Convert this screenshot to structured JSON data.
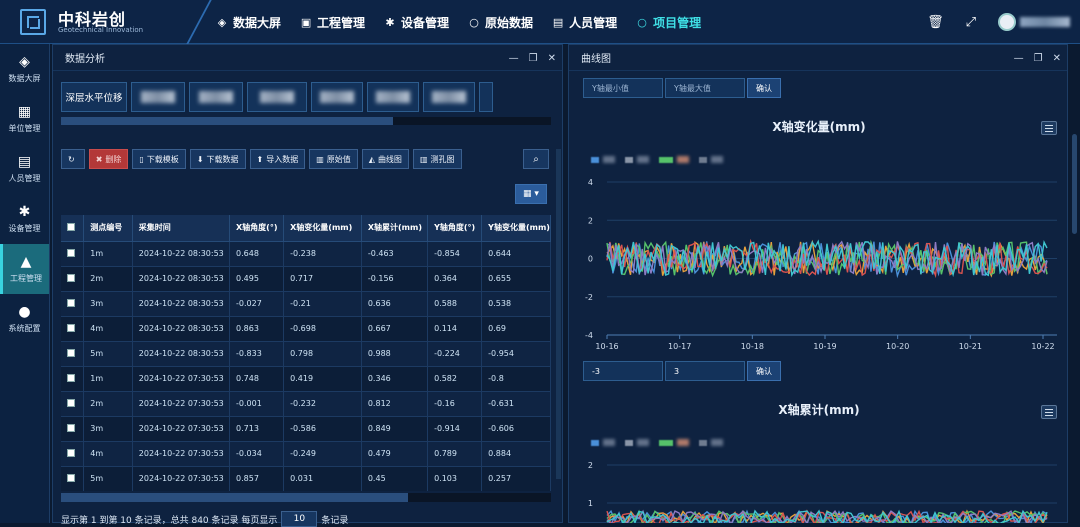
{
  "app": {
    "name_cn": "中科岩创",
    "name_en": "Geotechnical Innovation"
  },
  "nav": [
    {
      "label": "数据大屏",
      "icon": "cube-icon"
    },
    {
      "label": "工程管理",
      "icon": "monitor-icon"
    },
    {
      "label": "设备管理",
      "icon": "gear-icon"
    },
    {
      "label": "原始数据",
      "icon": "circle-icon"
    },
    {
      "label": "人员管理",
      "icon": "id-card-icon"
    },
    {
      "label": "项目管理",
      "icon": "circle-icon",
      "active": true
    }
  ],
  "sidebar": [
    {
      "label": "数据大屏",
      "icon": "cube-icon"
    },
    {
      "label": "单位管理",
      "icon": "calendar-icon"
    },
    {
      "label": "人员管理",
      "icon": "id-card-icon"
    },
    {
      "label": "设备管理",
      "icon": "gear-icon"
    },
    {
      "label": "工程管理",
      "icon": "chart-icon",
      "active": true
    },
    {
      "label": "系统配置",
      "icon": "dots-icon"
    }
  ],
  "left_panel": {
    "title": "数据分析",
    "tab_active": "深层水平位移",
    "toolbar": {
      "delete": "删除",
      "download_template": "下载模板",
      "download_data": "下载数据",
      "import_data": "导入数据",
      "raw_values": "原始值",
      "curve": "曲线图",
      "borehole": "测孔图"
    },
    "table": {
      "headers": [
        "测点编号",
        "采集时间",
        "X轴角度(°)",
        "X轴变化量(mm)",
        "X轴累计(mm)",
        "Y轴角度(°)",
        "Y轴变化量(mm)"
      ],
      "rows": [
        [
          "1m",
          "2024-10-22 08:30:53",
          "0.648",
          "-0.238",
          "-0.463",
          "-0.854",
          "0.644"
        ],
        [
          "2m",
          "2024-10-22 08:30:53",
          "0.495",
          "0.717",
          "-0.156",
          "0.364",
          "0.655"
        ],
        [
          "3m",
          "2024-10-22 08:30:53",
          "-0.027",
          "-0.21",
          "0.636",
          "0.588",
          "0.538"
        ],
        [
          "4m",
          "2024-10-22 08:30:53",
          "0.863",
          "-0.698",
          "0.667",
          "0.114",
          "0.69"
        ],
        [
          "5m",
          "2024-10-22 08:30:53",
          "-0.833",
          "0.798",
          "0.988",
          "-0.224",
          "-0.954"
        ],
        [
          "1m",
          "2024-10-22 07:30:53",
          "0.748",
          "0.419",
          "0.346",
          "0.582",
          "-0.8"
        ],
        [
          "2m",
          "2024-10-22 07:30:53",
          "-0.001",
          "-0.232",
          "0.812",
          "-0.16",
          "-0.631"
        ],
        [
          "3m",
          "2024-10-22 07:30:53",
          "0.713",
          "-0.586",
          "0.849",
          "-0.914",
          "-0.606"
        ],
        [
          "4m",
          "2024-10-22 07:30:53",
          "-0.034",
          "-0.249",
          "0.479",
          "0.789",
          "0.884"
        ],
        [
          "5m",
          "2024-10-22 07:30:53",
          "0.857",
          "0.031",
          "0.45",
          "0.103",
          "0.257"
        ]
      ]
    },
    "pager": {
      "text_a": "显示第 1 到第 10 条记录，总共 840 条记录 每页显示",
      "page_size": "10",
      "text_b": "条记录"
    }
  },
  "right_panel": {
    "title": "曲线图",
    "y_min_placeholder": "Y轴最小值",
    "y_max_placeholder": "Y轴最大值",
    "confirm": "确认",
    "y_min_value_2": "-3",
    "y_max_value_2": "3",
    "colors": [
      "#4a90d9",
      "#e6a13c",
      "#56c26a",
      "#d9534f",
      "#8e7cc3",
      "#3fc6d0"
    ],
    "chart_data": [
      {
        "type": "line",
        "title": "X轴变化量(mm)",
        "x_ticks": [
          "10-16",
          "10-17",
          "10-18",
          "10-19",
          "10-20",
          "10-21",
          "10-22"
        ],
        "y_ticks": [
          "4",
          "2",
          "0",
          "-2",
          "-4"
        ],
        "ylim": [
          -4,
          4
        ],
        "series_count": 6,
        "value_range": [
          -0.9,
          0.9
        ],
        "grid": true
      },
      {
        "type": "line",
        "title": "X轴累计(mm)",
        "y_ticks": [
          "2",
          "1"
        ],
        "series_count": 6
      }
    ]
  }
}
